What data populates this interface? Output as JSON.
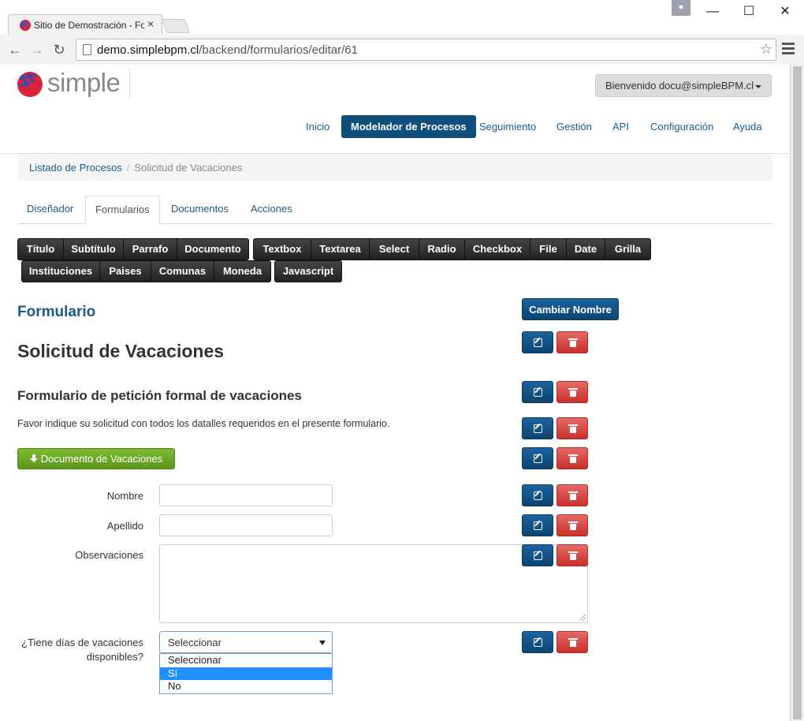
{
  "browser": {
    "tab_title": "Sitio de Demostración - Fo",
    "tab_close": "×",
    "url_prefix": "demo.simplebpm.cl",
    "url_path": "/backend/formularios/editar/61",
    "star": "☆",
    "win_min": "—",
    "win_max": "☐",
    "win_close": "✕",
    "back": "←",
    "forward": "→",
    "reload": "↻"
  },
  "header": {
    "logo_text": "simple",
    "user_menu": "Bienvenido docu@simpleBPM.cl"
  },
  "nav": {
    "items": [
      "Inicio",
      "Modelador de Procesos",
      "Seguimiento",
      "Gestión",
      "API",
      "Configuración",
      "Ayuda"
    ],
    "active": "Modelador de Procesos"
  },
  "breadcrumb": {
    "link": "Listado de Procesos",
    "sep": "/",
    "current": "Solicitud de Vacaciones"
  },
  "tabs": {
    "items": [
      "Diseñador",
      "Formularios",
      "Documentos",
      "Acciones"
    ],
    "active": "Formularios"
  },
  "toolbar": {
    "row1": [
      "Título",
      "Subtítulo",
      "Parrafo",
      "Documento",
      "Textbox",
      "Textarea",
      "Select",
      "Radio",
      "Checkbox",
      "File",
      "Date",
      "Grilla"
    ],
    "row2": [
      "Instituciones",
      "Paises",
      "Comunas",
      "Moneda",
      "Javascript"
    ]
  },
  "form_editor": {
    "heading": "Formulario",
    "rename_button": "Cambiar Nombre",
    "title": "Solicitud de Vacaciones",
    "subtitle": "Formulario de petición formal de vacaciones",
    "paragraph": "Favor indique su solicitud con todos los datalles requeridos en el presente formulario.",
    "document_button": "Documento de Vacaciones",
    "fields": {
      "nombre_label": "Nombre",
      "nombre_value": "",
      "apellido_label": "Apellido",
      "apellido_value": "",
      "observaciones_label": "Observaciones",
      "select_label_line1": "¿Tiene días de vacaciones",
      "select_label_line2": "disponibles?",
      "select_value": "Seleccionar",
      "select_options": [
        "Seleccionar",
        "Sí",
        "No"
      ],
      "select_highlighted": "Sí"
    }
  },
  "colors": {
    "primary": "#0e4f7c",
    "link": "#1a5a8a",
    "danger": "#d9534f",
    "success": "#6aa326",
    "toolbar": "#222222"
  }
}
